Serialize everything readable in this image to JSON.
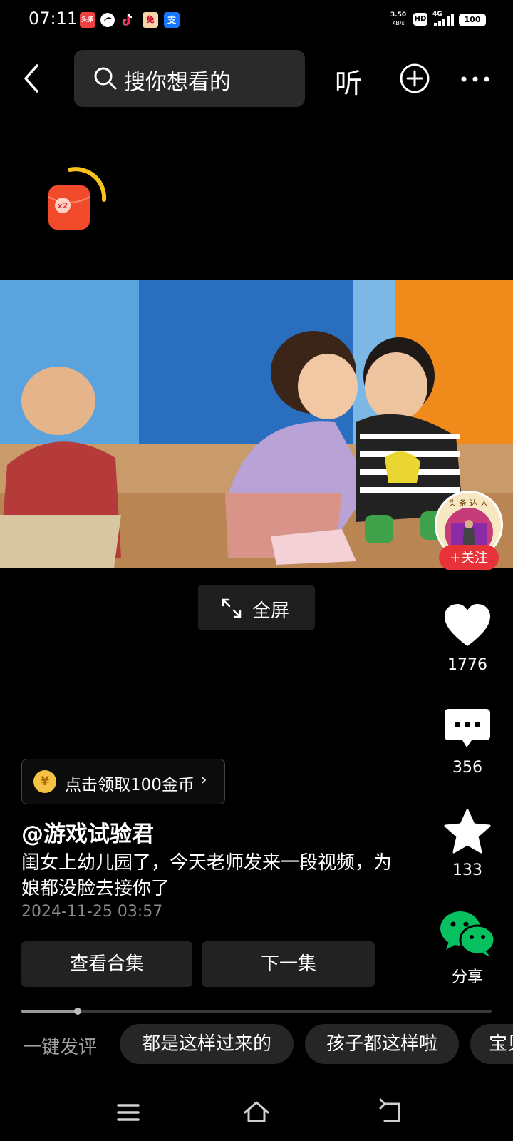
{
  "status_bar": {
    "time": "07:11",
    "net_speed_value": "3.50",
    "net_speed_unit": "KB/s",
    "hd": "HD",
    "network": "4G",
    "battery": "100",
    "notif_icon_1": "头条",
    "notif_icon_4": "免",
    "notif_icon_5": "支"
  },
  "top_nav": {
    "search_placeholder": "搜你想看的",
    "listen_label": "听"
  },
  "red_packet": {
    "multiplier": "x2"
  },
  "video": {
    "fullscreen_label": "全屏"
  },
  "author_avatar": {
    "caption": "头条达人"
  },
  "follow_label": "+关注",
  "actions": {
    "like_count": "1776",
    "comment_count": "356",
    "favorite_count": "133",
    "share_label": "分享"
  },
  "coin_badge": {
    "icon_char": "¥",
    "text": "点击领取100金币",
    "arrow": "›"
  },
  "post": {
    "author": "@游戏试验君",
    "description": "闺女上幼儿园了，今天老师发来一段视频，为娘都没脸去接你了",
    "date": "2024-11-25 03:57"
  },
  "buttons": {
    "collection_label": "查看合集",
    "next_label": "下一集"
  },
  "progress": {
    "played_fraction": 0.12
  },
  "quick_comment": {
    "label": "一键发评",
    "chips": [
      "都是这样过来的",
      "孩子都这样啦",
      "宝贝"
    ]
  },
  "colors": {
    "follow_red": "#e8323a",
    "coin_gold": "#f4c244",
    "share_green": "#07c160",
    "red_packet": "#f24b2c"
  }
}
